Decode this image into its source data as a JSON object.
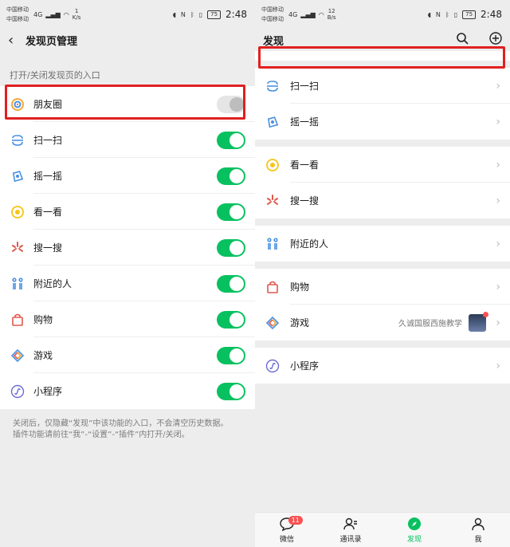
{
  "status_left": {
    "carrier1": "中国移动",
    "carrier2": "中国移动",
    "hd": "HD",
    "net": "4G",
    "speed_value": "1",
    "speed_unit": "K/s",
    "battery": "75",
    "time": "2:48"
  },
  "status_right": {
    "carrier1": "中国移动",
    "carrier2": "中国移动",
    "hd": "HD",
    "net": "4G",
    "speed_value": "12",
    "speed_unit": "B/s",
    "battery": "75",
    "time": "2:48"
  },
  "left": {
    "nav_title": "发现页管理",
    "section_hint": "打开/关闭发现页的入口",
    "items": [
      {
        "label": "朋友圈",
        "on": false
      },
      {
        "label": "扫一扫",
        "on": true
      },
      {
        "label": "摇一摇",
        "on": true
      },
      {
        "label": "看一看",
        "on": true
      },
      {
        "label": "搜一搜",
        "on": true
      },
      {
        "label": "附近的人",
        "on": true
      },
      {
        "label": "购物",
        "on": true
      },
      {
        "label": "游戏",
        "on": true
      },
      {
        "label": "小程序",
        "on": true
      }
    ],
    "note_line1": "关闭后，仅隐藏“发现”中该功能的入口，不会清空历史数据。",
    "note_line2": "插件功能请前往“我”-“设置”-“插件”内打开/关闭。"
  },
  "right": {
    "nav_title": "发现",
    "items": {
      "scan": "扫一扫",
      "shake": "摇一摇",
      "look": "看一看",
      "search": "搜一搜",
      "nearby": "附近的人",
      "shop": "购物",
      "game": "游戏",
      "game_extra": "久诚国服西施教学",
      "mini": "小程序"
    },
    "tabs": [
      {
        "label": "微信",
        "badge": "11"
      },
      {
        "label": "通讯录"
      },
      {
        "label": "发现"
      },
      {
        "label": "我"
      }
    ]
  },
  "colors": {
    "accent": "#07c160",
    "highlight": "#e02020",
    "badge": "#fa5151"
  }
}
